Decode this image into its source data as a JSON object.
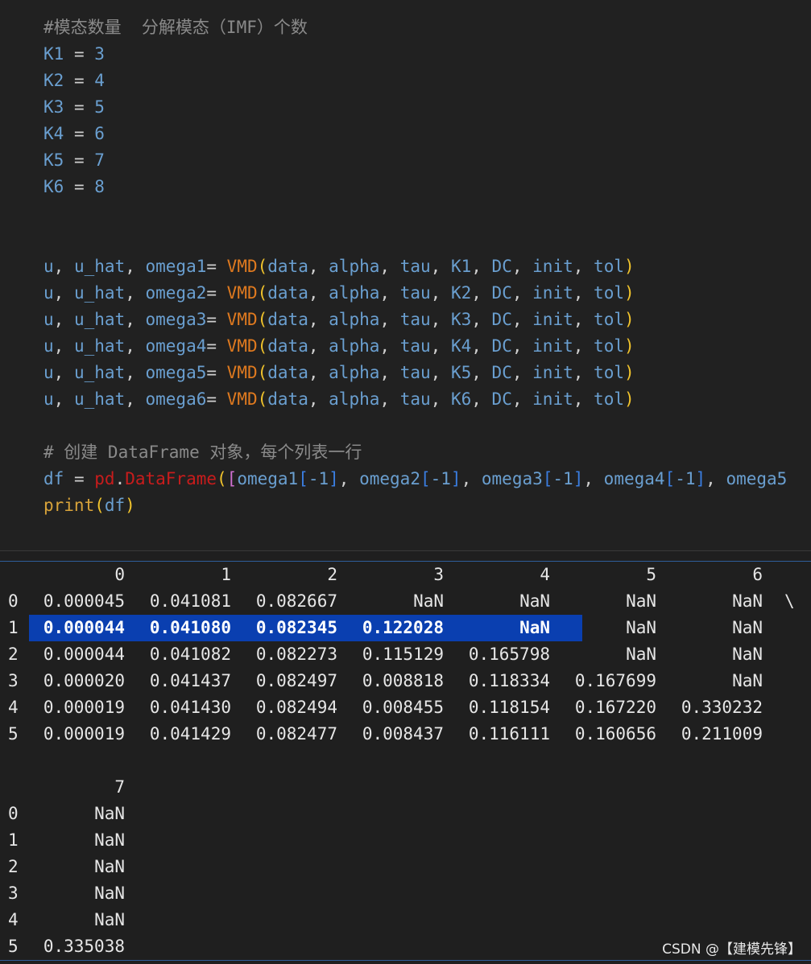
{
  "code": {
    "comment1": "#模态数量  分解模态（IMF）个数",
    "k_assign": [
      {
        "name": "K1",
        "value": "3"
      },
      {
        "name": "K2",
        "value": "4"
      },
      {
        "name": "K3",
        "value": "5"
      },
      {
        "name": "K4",
        "value": "6"
      },
      {
        "name": "K5",
        "value": "7"
      },
      {
        "name": "K6",
        "value": "8"
      }
    ],
    "vmd_lines": [
      {
        "omega": "omega1",
        "k": "K1"
      },
      {
        "omega": "omega2",
        "k": "K2"
      },
      {
        "omega": "omega3",
        "k": "K3"
      },
      {
        "omega": "omega4",
        "k": "K4"
      },
      {
        "omega": "omega5",
        "k": "K5"
      },
      {
        "omega": "omega6",
        "k": "K6"
      }
    ],
    "tokens": {
      "u": "u",
      "comma": ",",
      "u_hat": "u_hat",
      "eq": "=",
      "vmd": "VMD",
      "lp": "(",
      "rp": ")",
      "data": "data",
      "alpha": "alpha",
      "tau": "tau",
      "DC": "DC",
      "init": "init",
      "tol": "tol"
    },
    "comment2": "# 创建 DataFrame 对象，每个列表一行",
    "df_line": {
      "df": "df",
      "pd": "pd",
      "dot": ".",
      "DataFrame": "DataFrame",
      "omega_items": [
        "omega1",
        "omega2",
        "omega3",
        "omega4"
      ],
      "trunc": "omega5",
      "minus_one": "-1"
    },
    "print_line": {
      "fn": "print",
      "arg": "df"
    }
  },
  "output": {
    "headers": [
      "0",
      "1",
      "2",
      "3",
      "4",
      "5",
      "6"
    ],
    "continuation": "\\",
    "rows": [
      {
        "idx": "0",
        "vals": [
          "0.000045",
          "0.041081",
          "0.082667",
          "NaN",
          "NaN",
          "NaN",
          "NaN"
        ]
      },
      {
        "idx": "1",
        "vals": [
          "0.000044",
          "0.041080",
          "0.082345",
          "0.122028",
          "NaN",
          "NaN",
          "NaN"
        ]
      },
      {
        "idx": "2",
        "vals": [
          "0.000044",
          "0.041082",
          "0.082273",
          "0.115129",
          "0.165798",
          "NaN",
          "NaN"
        ]
      },
      {
        "idx": "3",
        "vals": [
          "0.000020",
          "0.041437",
          "0.082497",
          "0.008818",
          "0.118334",
          "0.167699",
          "NaN"
        ]
      },
      {
        "idx": "4",
        "vals": [
          "0.000019",
          "0.041430",
          "0.082494",
          "0.008455",
          "0.118154",
          "0.167220",
          "0.330232"
        ]
      },
      {
        "idx": "5",
        "vals": [
          "0.000019",
          "0.041429",
          "0.082477",
          "0.008437",
          "0.116111",
          "0.160656",
          "0.211009"
        ]
      }
    ],
    "headers2": [
      "7"
    ],
    "rows2": [
      {
        "idx": "0",
        "val": "NaN"
      },
      {
        "idx": "1",
        "val": "NaN"
      },
      {
        "idx": "2",
        "val": "NaN"
      },
      {
        "idx": "3",
        "val": "NaN"
      },
      {
        "idx": "4",
        "val": "NaN"
      },
      {
        "idx": "5",
        "val": "0.335038"
      }
    ],
    "highlighted_row": 1
  },
  "watermark": "CSDN @【建模先锋】",
  "colors": {
    "background": "#1f1f1f",
    "selection": "#0a3fb0",
    "function": "#e07a1f",
    "paren": "#f2c42c",
    "identifier": "#6a9fd0",
    "comment": "#8a8a8a"
  }
}
